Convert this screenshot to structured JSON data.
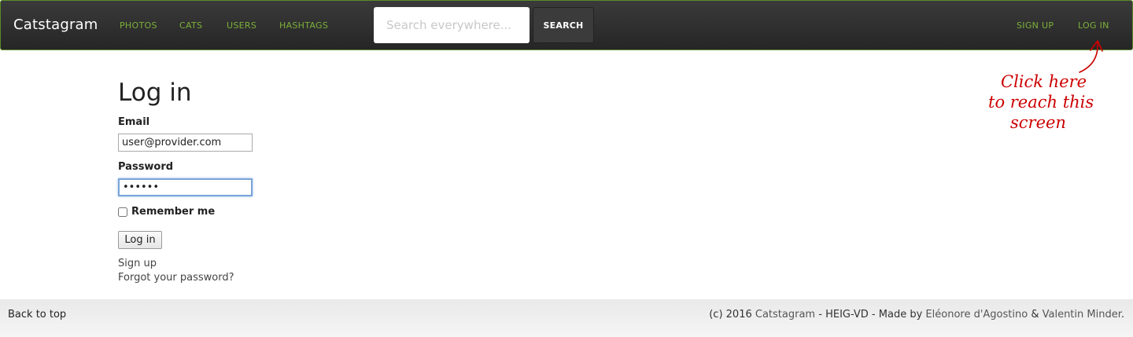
{
  "navbar": {
    "brand": "Catstagram",
    "links": [
      "PHOTOS",
      "CATS",
      "USERS",
      "HASHTAGS"
    ],
    "search_placeholder": "Search everywhere...",
    "search_button": "SEARCH",
    "signup": "SIGN UP",
    "login": "LOG IN",
    "accent_color": "#7cb03a",
    "bar_color": "#2e2e2e"
  },
  "form": {
    "title": "Log in",
    "email_label": "Email",
    "email_value": "user@provider.com",
    "password_label": "Password",
    "password_value": "••••••",
    "remember_label": "Remember me",
    "remember_checked": false,
    "submit": "Log in",
    "signup_link": "Sign up",
    "forgot_link": "Forgot your password?"
  },
  "annotation": {
    "line1": "Click here",
    "line2": "to reach this",
    "line3": "screen",
    "color": "#cc0000"
  },
  "footer": {
    "back_to_top": "Back to top",
    "copyright": "(c) 2016",
    "site_link": "Catstagram",
    "org": "- HEIG-VD - Made by",
    "author1": "Eléonore d'Agostino",
    "and": "&",
    "author2": "Valentin Minder",
    "period": "."
  }
}
